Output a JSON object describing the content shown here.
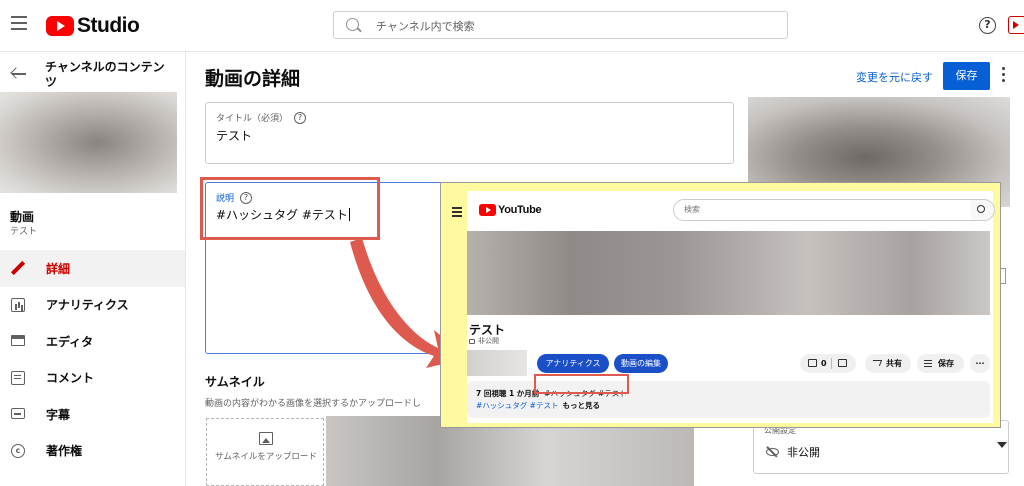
{
  "header": {
    "logo_text": "Studio",
    "search_placeholder": "チャンネル内で検索"
  },
  "sidebar": {
    "title": "チャンネルのコンテンツ",
    "video_title": "動画",
    "video_subtitle": "テスト",
    "items": [
      {
        "label": "詳細",
        "icon": "pencil-icon",
        "active": true
      },
      {
        "label": "アナリティクス",
        "icon": "analytics-icon"
      },
      {
        "label": "エディタ",
        "icon": "editor-icon"
      },
      {
        "label": "コメント",
        "icon": "comments-icon"
      },
      {
        "label": "字幕",
        "icon": "subtitles-icon"
      },
      {
        "label": "著作権",
        "icon": "copyright-icon"
      }
    ]
  },
  "main": {
    "page_title": "動画の詳細",
    "undo_label": "変更を元に戻す",
    "save_label": "保存",
    "title_field": {
      "label": "タイトル（必須）",
      "value": "テスト"
    },
    "description_field": {
      "label": "説明",
      "value": "#ハッシュタグ #テスト"
    },
    "thumbnail": {
      "heading": "サムネイル",
      "description": "動画の内容がわかる画像を選択するかアップロードし",
      "upload_label": "サムネイルをアップロード"
    },
    "visibility": {
      "label": "公開設定",
      "value": "非公開"
    }
  },
  "overlay": {
    "logo_text": "YouTube",
    "search_placeholder": "検索",
    "video_title": "テスト",
    "privacy": "非公開",
    "analytics_button": "アナリティクス",
    "edit_button": "動画の編集",
    "like_count": "0",
    "share_label": "共有",
    "save_label": "保存",
    "more_label": "···",
    "desc_meta": "7 回視聴  1 か月前",
    "desc_hashtags": "#ハッシュタグ #テスト",
    "desc_tags_line": "#ハッシュタグ #テスト",
    "desc_more": "もっと見る"
  },
  "colors": {
    "accent_red": "#cc0000",
    "callout": "#de5a4f",
    "overlay_bg": "#fffaa0",
    "link_blue": "#065fd4"
  }
}
